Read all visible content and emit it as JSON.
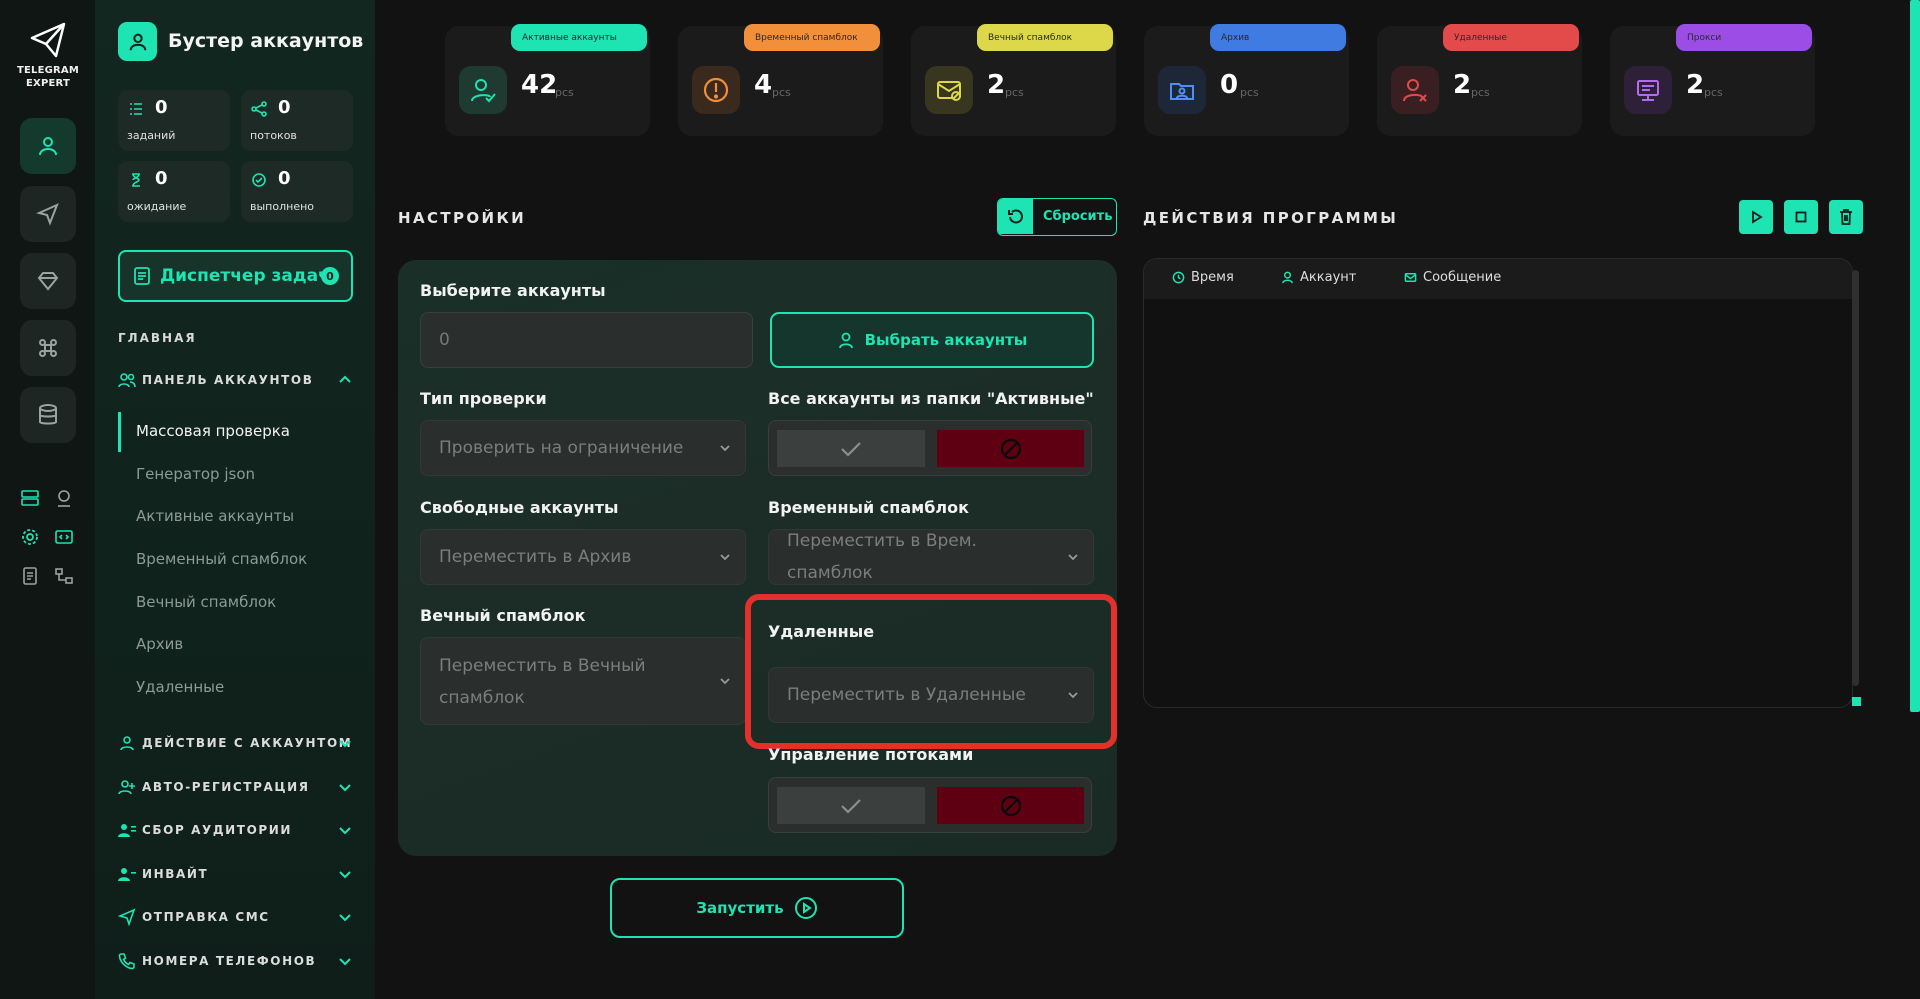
{
  "logo": {
    "line1": "TELEGRAM",
    "line2": "EXPERT"
  },
  "sidebar": {
    "title": "Бустер аккаунтов",
    "stats": [
      {
        "value": "0",
        "label": "заданий",
        "icon": "list-icon"
      },
      {
        "value": "0",
        "label": "потоков",
        "icon": "share-icon"
      },
      {
        "value": "0",
        "label": "ожидание",
        "icon": "hourglass-icon"
      },
      {
        "value": "0",
        "label": "выполнено",
        "icon": "check-circle-icon"
      }
    ],
    "task_manager": {
      "label": "Диспетчер задач",
      "badge": "0"
    },
    "section_main": "ГЛАВНАЯ",
    "account_panel": {
      "label": "ПАНЕЛЬ АККАУНТОВ",
      "items": [
        "Массовая проверка",
        "Генератор json",
        "Активные аккаунты",
        "Временный спамблок",
        "Вечный спамблок",
        "Архив",
        "Удаленные"
      ]
    },
    "groups": [
      "ДЕЙСТВИЕ С АККАУНТОМ",
      "АВТО-РЕГИСТРАЦИЯ",
      "СБОР АУДИТОРИИ",
      "ИНВАЙТ",
      "ОТПРАВКА СМС",
      "НОМЕРА ТЕЛЕФОНОВ"
    ]
  },
  "categories": [
    {
      "tag": "Активные аккаунты",
      "value": "42",
      "unit": "pcs",
      "color": "#1ee3b3",
      "icon": "user-check-icon"
    },
    {
      "tag": "Временный спамблок",
      "value": "4",
      "unit": "pcs",
      "color": "#f28f3b",
      "icon": "alert-circle-icon"
    },
    {
      "tag": "Вечный спамблок",
      "value": "2",
      "unit": "pcs",
      "color": "#ddd84a",
      "icon": "mail-block-icon"
    },
    {
      "tag": "Архив",
      "value": "0",
      "unit": "pcs",
      "color": "#3f7be0",
      "icon": "archive-folder-icon"
    },
    {
      "tag": "Удаленные",
      "value": "2",
      "unit": "pcs",
      "color": "#e34b4b",
      "icon": "user-x-icon"
    },
    {
      "tag": "Прокси",
      "value": "2",
      "unit": "pcs",
      "color": "#9b4de6",
      "icon": "proxy-icon"
    }
  ],
  "settings": {
    "title": "НАСТРОЙКИ",
    "reset_label": "Сбросить",
    "select_accounts_label": "Выберите аккаунты",
    "select_accounts_value": "0",
    "select_accounts_button": "Выбрать аккаунты",
    "check_type_label": "Тип проверки",
    "check_type_value": "Проверить на ограничение",
    "all_active_label": "Все аккаунты из папки \"Активные\"",
    "free_accounts_label": "Свободные аккаунты",
    "free_accounts_value": "Переместить в Архив",
    "temp_spamblock_label": "Временный спамблок",
    "temp_spamblock_value": "Переместить в Врем. спамблок",
    "perm_spamblock_label": "Вечный спамблок",
    "perm_spamblock_value": "Переместить в Вечный спамблок",
    "deleted_label": "Удаленные",
    "deleted_value": "Переместить в Удаленные",
    "threads_label": "Управление потоками",
    "run_label": "Запустить"
  },
  "log": {
    "title": "ДЕЙСТВИЯ ПРОГРАММЫ",
    "columns": [
      "Время",
      "Аккаунт",
      "Сообщение"
    ]
  },
  "colors": {
    "accent": "#1ee3b3",
    "danger": "#5e0012",
    "highlight": "#e3302b"
  }
}
